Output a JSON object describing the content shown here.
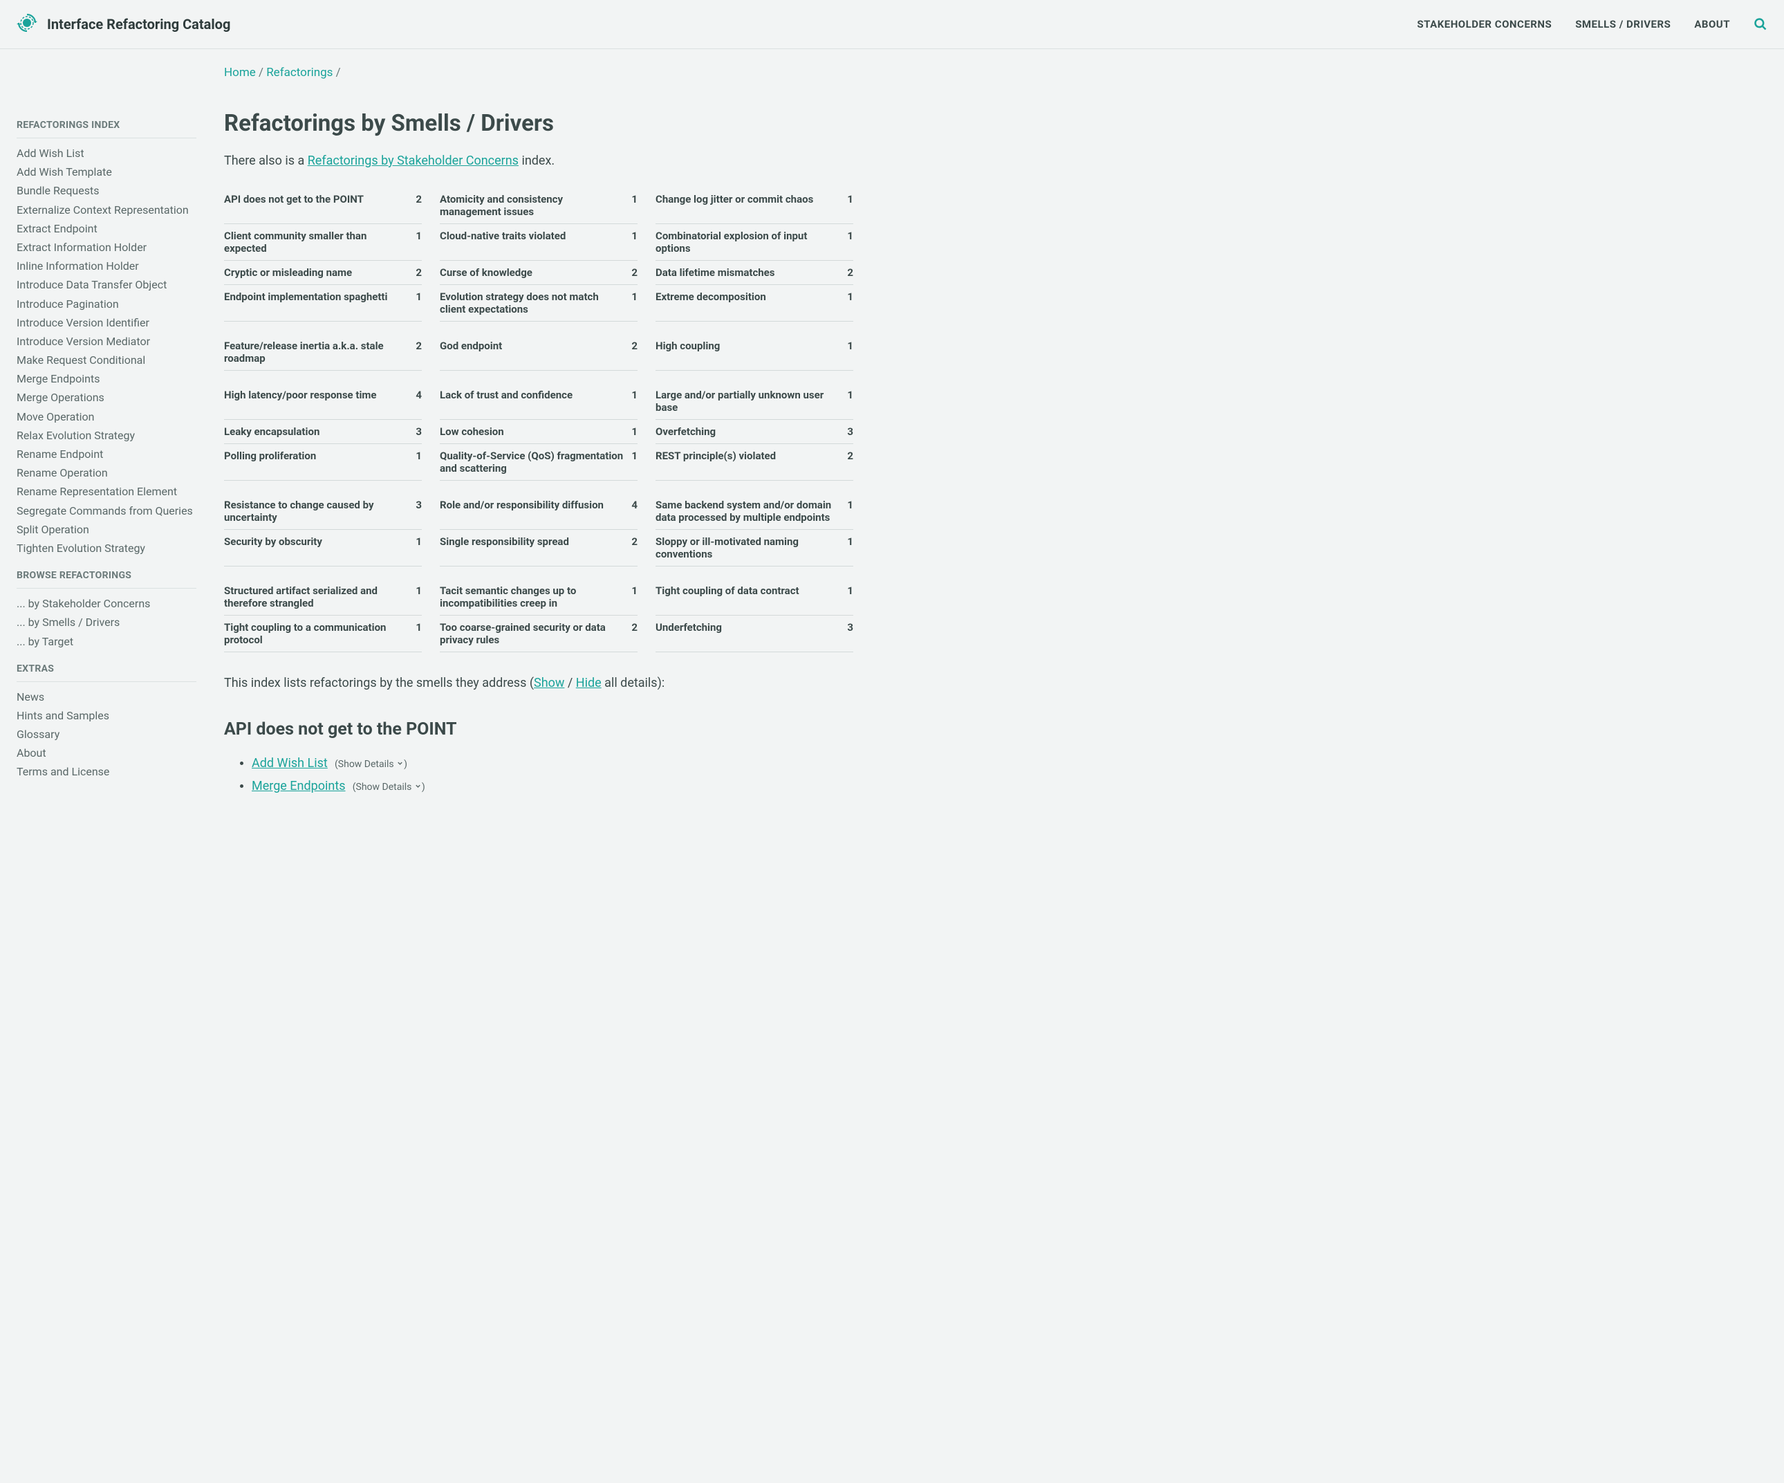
{
  "header": {
    "brand": "Interface Refactoring Catalog",
    "nav": [
      "STAKEHOLDER CONCERNS",
      "SMELLS / DRIVERS",
      "ABOUT"
    ]
  },
  "breadcrumb": {
    "home": "Home",
    "sep1": " / ",
    "refactorings": "Refactorings",
    "sep2": " /"
  },
  "title": "Refactorings by Smells / Drivers",
  "lead_before": "There also is a ",
  "lead_link": "Refactorings by Stakeholder Concerns",
  "lead_after": " index.",
  "sidebar": {
    "index_title": "REFACTORINGS INDEX",
    "index_items": [
      "Add Wish List",
      "Add Wish Template",
      "Bundle Requests",
      "Externalize Context Representation",
      "Extract Endpoint",
      "Extract Information Holder",
      "Inline Information Holder",
      "Introduce Data Transfer Object",
      "Introduce Pagination",
      "Introduce Version Identifier",
      "Introduce Version Mediator",
      "Make Request Conditional",
      "Merge Endpoints",
      "Merge Operations",
      "Move Operation",
      "Relax Evolution Strategy",
      "Rename Endpoint",
      "Rename Operation",
      "Rename Representation Element",
      "Segregate Commands from Queries",
      "Split Operation",
      "Tighten Evolution Strategy"
    ],
    "browse_title": "BROWSE REFACTORINGS",
    "browse_items": [
      "... by Stakeholder Concerns",
      "... by Smells / Drivers",
      "... by Target"
    ],
    "extras_title": "EXTRAS",
    "extras_items": [
      "News",
      "Hints and Samples",
      "Glossary",
      "About",
      "Terms and License"
    ]
  },
  "smell_groups": [
    [
      {
        "label": "API does not get to the POINT",
        "count": 2
      },
      {
        "label": "Atomicity and consistency management issues",
        "count": 1
      },
      {
        "label": "Change log jitter or commit chaos",
        "count": 1
      }
    ],
    [
      {
        "label": "Client community smaller than expected",
        "count": 1
      },
      {
        "label": "Cloud-native traits violated",
        "count": 1
      },
      {
        "label": "Combinatorial explosion of input options",
        "count": 1
      }
    ],
    [
      {
        "label": "Cryptic or misleading name",
        "count": 2
      },
      {
        "label": "Curse of knowledge",
        "count": 2
      },
      {
        "label": "Data lifetime mismatches",
        "count": 2
      }
    ],
    [
      {
        "label": "Endpoint implementation spaghetti",
        "count": 1
      },
      {
        "label": "Evolution strategy does not match client expectations",
        "count": 1
      },
      {
        "label": "Extreme decomposition",
        "count": 1
      }
    ],
    [
      {
        "label": "Feature/release inertia a.k.a. stale roadmap",
        "count": 2
      },
      {
        "label": "God endpoint",
        "count": 2
      },
      {
        "label": "High coupling",
        "count": 1
      }
    ],
    [
      {
        "label": "High latency/poor response time",
        "count": 4
      },
      {
        "label": "Lack of trust and confidence",
        "count": 1
      },
      {
        "label": "Large and/or partially unknown user base",
        "count": 1
      }
    ],
    [
      {
        "label": "Leaky encapsulation",
        "count": 3
      },
      {
        "label": "Low cohesion",
        "count": 1
      },
      {
        "label": "Overfetching",
        "count": 3
      }
    ],
    [
      {
        "label": "Polling proliferation",
        "count": 1
      },
      {
        "label": "Quality-of-Service (QoS) fragmentation and scattering",
        "count": 1
      },
      {
        "label": "REST principle(s) violated",
        "count": 2
      }
    ],
    [
      {
        "label": "Resistance to change caused by uncertainty",
        "count": 3
      },
      {
        "label": "Role and/or responsibility diffusion",
        "count": 4
      },
      {
        "label": "Same backend system and/or domain data processed by multiple endpoints",
        "count": 1
      }
    ],
    [
      {
        "label": "Security by obscurity",
        "count": 1
      },
      {
        "label": "Single responsibility spread",
        "count": 2
      },
      {
        "label": "Sloppy or ill-motivated naming conventions",
        "count": 1
      }
    ],
    [
      {
        "label": "Structured artifact serialized and therefore strangled",
        "count": 1
      },
      {
        "label": "Tacit semantic changes up to incompatibilities creep in",
        "count": 1
      },
      {
        "label": "Tight coupling of data contract",
        "count": 1
      }
    ],
    [
      {
        "label": "Tight coupling to a communication protocol",
        "count": 1
      },
      {
        "label": "Too coarse-grained security or data privacy rules",
        "count": 2
      },
      {
        "label": "Underfetching",
        "count": 3
      }
    ]
  ],
  "details_note": {
    "before": "This index lists refactorings by the smells they address (",
    "show": "Show",
    "sep": " / ",
    "hide": "Hide",
    "after": " all details):"
  },
  "section": {
    "heading": "API does not get to the POINT",
    "items": [
      {
        "link": "Add Wish List",
        "details": "(Show Details "
      },
      {
        "link": "Merge Endpoints",
        "details": "(Show Details "
      }
    ]
  }
}
